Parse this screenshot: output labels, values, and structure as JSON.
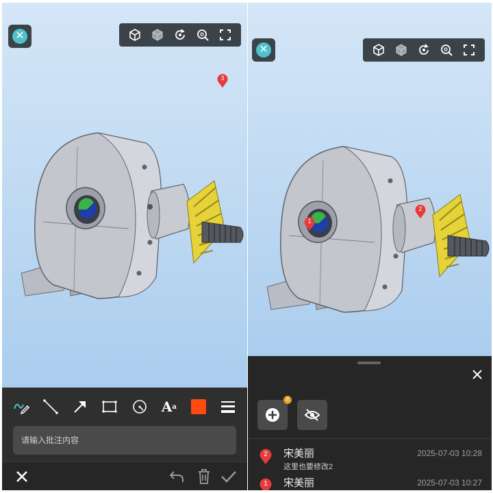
{
  "left_panel": {
    "pin_label": "3",
    "input": {
      "placeholder": "请输入批注内容"
    },
    "tools": [
      "freehand-pen",
      "line",
      "arrow",
      "rectangle",
      "circle",
      "text-size",
      "color",
      "line-weight"
    ],
    "accent_color": "#ff4a0e"
  },
  "right_panel": {
    "pins": [
      "1",
      "2"
    ],
    "toolbar_icons": [
      "view-cube",
      "shaded-cube",
      "rotate",
      "zoom-fit",
      "fullscreen"
    ],
    "add_badge": "8",
    "comments": [
      {
        "pin": "2",
        "author": "宋美丽",
        "time": "2025-07-03 10:28",
        "text": "这里也要修改2"
      },
      {
        "pin": "1",
        "author": "宋美丽",
        "time": "2025-07-03 10:27",
        "text": ""
      }
    ]
  },
  "colors": {
    "sky_top": "#d4e6f7",
    "sky_bottom": "#aacdee",
    "toolbar_bg": "#3b4248",
    "close_accent": "#4fc1c9",
    "pin_red": "#e63b3b",
    "gear_yellow": "#e6d23a",
    "sheet_bg": "#262626"
  }
}
